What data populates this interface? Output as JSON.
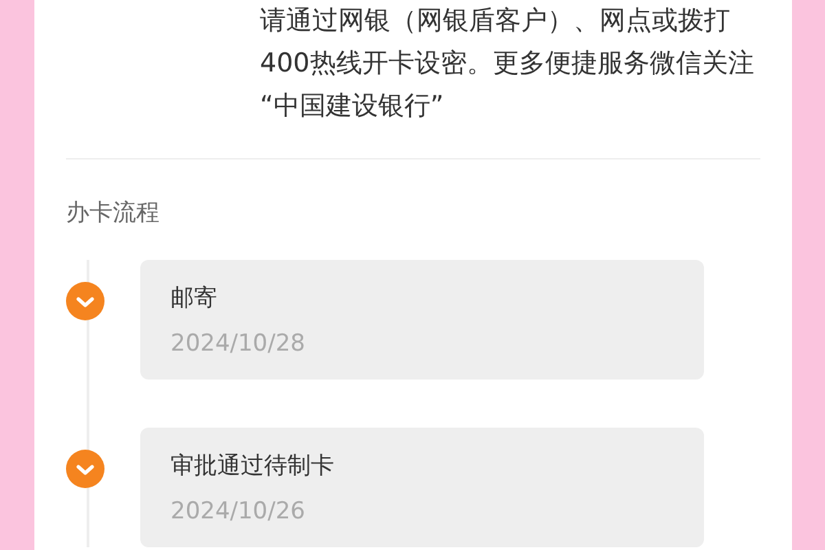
{
  "notice": {
    "lines": [
      "请通过网银（网银盾客户）、网点或拨打",
      "400热线开卡设密。更多便捷服务微信关注",
      "“中国建设银行”"
    ]
  },
  "process": {
    "title": "办卡流程",
    "steps": [
      {
        "title": "邮寄",
        "date": "2024/10/28",
        "done": true
      },
      {
        "title": "审批通过待制卡",
        "date": "2024/10/26",
        "done": true
      }
    ]
  }
}
